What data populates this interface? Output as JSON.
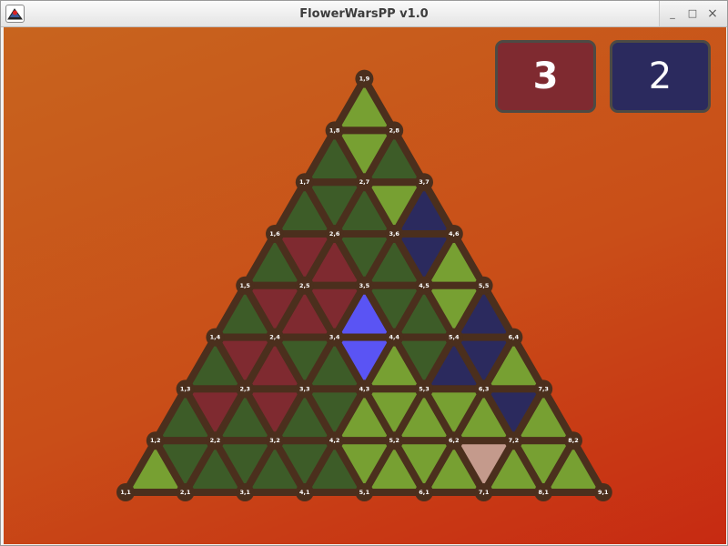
{
  "window": {
    "title": "FlowerWarsPP v1.0",
    "controls": {
      "minimize": "_",
      "maximize": "□",
      "close": "×"
    }
  },
  "scores": {
    "red": "3",
    "blue": "2"
  },
  "board": {
    "size": 9,
    "colors": {
      "edge": "#4b2f1d",
      "vertex": "#4b2f1d",
      "empty_light": "#77a032",
      "empty_dark": "#3d5c28",
      "red_flower": "#7f2a30",
      "blue_flower": "#2b2a5e",
      "blue_selected": "#5a54f4",
      "highlight": "#c49a8c"
    },
    "vertices": [
      "1,1",
      "2,1",
      "3,1",
      "4,1",
      "5,1",
      "6,1",
      "7,1",
      "8,1",
      "9,1",
      "1,2",
      "2,2",
      "3,2",
      "4,2",
      "5,2",
      "6,2",
      "7,2",
      "8,2",
      "1,3",
      "2,3",
      "3,3",
      "4,3",
      "5,3",
      "6,3",
      "7,3",
      "1,4",
      "2,4",
      "3,4",
      "4,4",
      "5,4",
      "6,4",
      "1,5",
      "2,5",
      "3,5",
      "4,5",
      "5,5",
      "1,6",
      "2,6",
      "3,6",
      "4,6",
      "1,7",
      "2,7",
      "3,7",
      "1,8",
      "2,8",
      "1,9"
    ],
    "up_triangles": [
      [
        "L",
        "D",
        "D",
        "D",
        "L",
        "L",
        "L",
        "L"
      ],
      [
        "D",
        "D",
        "D",
        "L",
        "L",
        "L",
        "L"
      ],
      [
        "D",
        "R",
        "D",
        "L",
        "B",
        "L"
      ],
      [
        "D",
        "R",
        "S",
        "D",
        "B"
      ],
      [
        "D",
        "R",
        "D",
        "L"
      ],
      [
        "D",
        "D",
        "B"
      ],
      [
        "D",
        "D"
      ],
      [
        "L"
      ]
    ],
    "down_triangles": [
      [
        "D",
        "D",
        "D",
        "L",
        "L",
        "H",
        "L"
      ],
      [
        "R",
        "R",
        "D",
        "L",
        "L",
        "B"
      ],
      [
        "R",
        "D",
        "S",
        "D",
        "B"
      ],
      [
        "R",
        "R",
        "D",
        "L"
      ],
      [
        "R",
        "D",
        "B"
      ],
      [
        "D",
        "L"
      ],
      [
        "L"
      ]
    ]
  }
}
